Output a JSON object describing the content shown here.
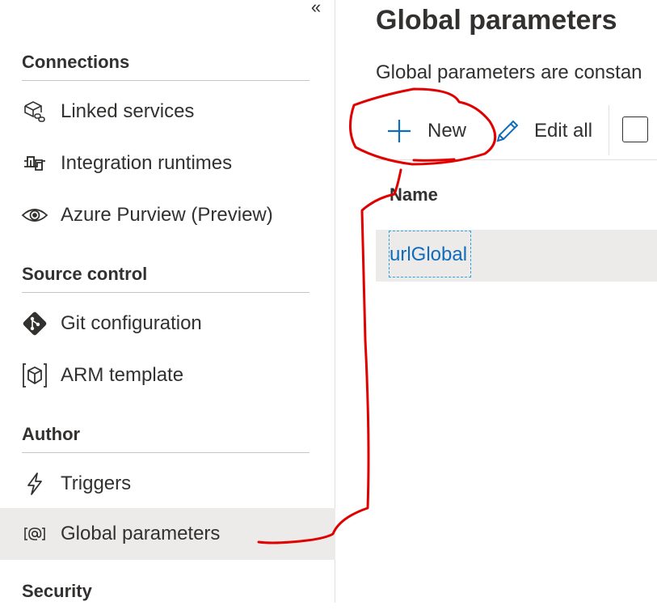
{
  "sidebar": {
    "collapse_glyph": "«",
    "sections": [
      {
        "title": "Connections"
      },
      {
        "title": "Source control"
      },
      {
        "title": "Author"
      },
      {
        "title": "Security"
      }
    ],
    "items": [
      {
        "label": "Linked services",
        "icon": "linked-services-icon"
      },
      {
        "label": "Integration runtimes",
        "icon": "integration-runtimes-icon"
      },
      {
        "label": "Azure Purview (Preview)",
        "icon": "eye-icon"
      },
      {
        "label": "Git configuration",
        "icon": "git-icon"
      },
      {
        "label": "ARM template",
        "icon": "arm-template-icon"
      },
      {
        "label": "Triggers",
        "icon": "lightning-icon"
      },
      {
        "label": "Global parameters",
        "icon": "global-parameters-icon",
        "active": true
      }
    ]
  },
  "main": {
    "title": "Global parameters",
    "description": "Global parameters are constan",
    "toolbar": {
      "new_label": "New",
      "edit_all_label": "Edit all"
    },
    "table": {
      "column_name": "Name",
      "rows": [
        {
          "name": "urlGlobal"
        }
      ]
    }
  },
  "colors": {
    "accent": "#0f6cbd",
    "active_bg": "#edebe9",
    "annotation": "#e00000"
  }
}
